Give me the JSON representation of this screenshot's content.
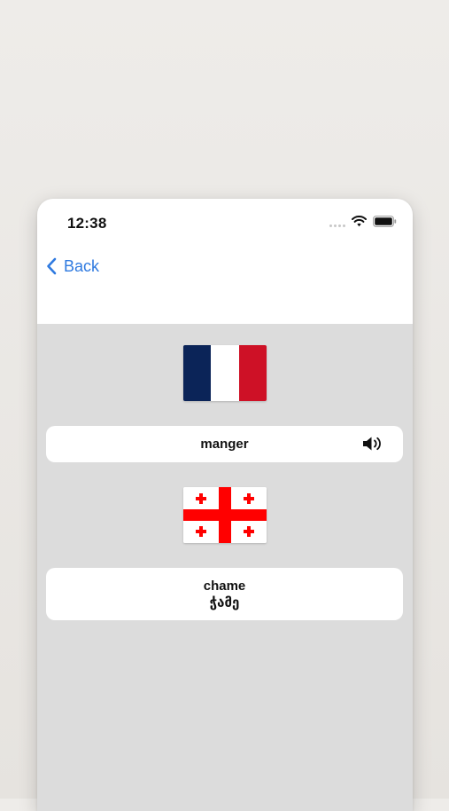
{
  "status_bar": {
    "time": "12:38"
  },
  "nav": {
    "back_label": "Back"
  },
  "source": {
    "flag": "france-flag",
    "word": "manger"
  },
  "target": {
    "flag": "georgia-flag",
    "transliteration": "chame",
    "word": "ჭამე"
  },
  "icons": {
    "back": "chevron-left-icon",
    "speaker": "speaker-icon",
    "wifi": "wifi-icon",
    "battery": "battery-icon"
  },
  "colors": {
    "accent": "#2f7ae0",
    "background": "#dcdcdc",
    "card": "#ffffff"
  }
}
